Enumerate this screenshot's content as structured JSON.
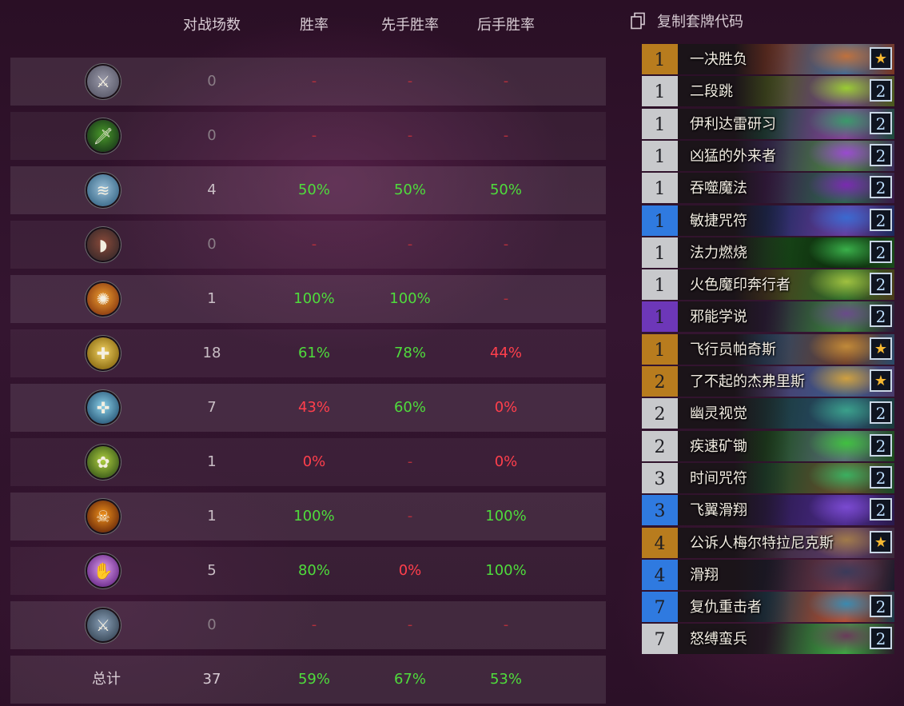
{
  "header": {
    "games": "对战场数",
    "winrate": "胜率",
    "first_winrate": "先手胜率",
    "second_winrate": "后手胜率"
  },
  "matchups": [
    {
      "icon": "warrior-class-icon",
      "games": "0",
      "winrate": "-",
      "first": "-",
      "second": "-"
    },
    {
      "icon": "rogue-class-icon",
      "games": "0",
      "winrate": "-",
      "first": "-",
      "second": "-"
    },
    {
      "icon": "shaman-class-icon",
      "games": "4",
      "winrate": "50%",
      "first": "50%",
      "second": "50%"
    },
    {
      "icon": "hunter-class-icon",
      "games": "0",
      "winrate": "-",
      "first": "-",
      "second": "-"
    },
    {
      "icon": "mage-class-icon",
      "games": "1",
      "winrate": "100%",
      "first": "100%",
      "second": "-"
    },
    {
      "icon": "paladin-class-icon",
      "games": "18",
      "winrate": "61%",
      "first": "78%",
      "second": "44%"
    },
    {
      "icon": "priest-class-icon",
      "games": "7",
      "winrate": "43%",
      "first": "60%",
      "second": "0%"
    },
    {
      "icon": "druid-class-icon",
      "games": "1",
      "winrate": "0%",
      "first": "-",
      "second": "0%"
    },
    {
      "icon": "warlock-class-icon",
      "games": "1",
      "winrate": "100%",
      "first": "-",
      "second": "100%"
    },
    {
      "icon": "demon-hunter-class-icon",
      "games": "5",
      "winrate": "80%",
      "first": "0%",
      "second": "100%"
    },
    {
      "icon": "death-knight-class-icon",
      "games": "0",
      "winrate": "-",
      "first": "-",
      "second": "-"
    }
  ],
  "total": {
    "label": "总计",
    "games": "37",
    "winrate": "59%",
    "first": "67%",
    "second": "53%"
  },
  "colors": {
    "win": "#4fdc3c",
    "loss": "#ff3f4c",
    "dash": "#b3303c",
    "common": "#c8c9cc",
    "legendary": "#b87c1e",
    "rare": "#2f7ae0",
    "epic": "#6d37b8"
  },
  "copy_deck": {
    "label": "复制套牌代码",
    "icon": "copy-icon"
  },
  "deck": [
    {
      "cost": "1",
      "name": "一决胜负",
      "rarity": "legendary",
      "qty": "★",
      "art": [
        "#7a3520",
        "#c0703c",
        "#3a6a9a"
      ]
    },
    {
      "cost": "1",
      "name": "二段跳",
      "rarity": "common",
      "qty": "2",
      "art": [
        "#4a5a1a",
        "#9acd32",
        "#6b3a8a"
      ]
    },
    {
      "cost": "1",
      "name": "伊利达雷研习",
      "rarity": "common",
      "qty": "2",
      "art": [
        "#1a4a3a",
        "#3a9a6a",
        "#8a3a9a"
      ]
    },
    {
      "cost": "1",
      "name": "凶猛的外来者",
      "rarity": "common",
      "qty": "2",
      "art": [
        "#3a2a5a",
        "#9a4ad0",
        "#4a8a3a"
      ]
    },
    {
      "cost": "1",
      "name": "吞噬魔法",
      "rarity": "common",
      "qty": "2",
      "art": [
        "#3a1a4a",
        "#7a2ab0",
        "#2a6a4a"
      ]
    },
    {
      "cost": "1",
      "name": "敏捷咒符",
      "rarity": "rare",
      "qty": "2",
      "art": [
        "#1a2a5a",
        "#3a6ad0",
        "#6a3a9a"
      ]
    },
    {
      "cost": "1",
      "name": "法力燃烧",
      "rarity": "common",
      "qty": "2",
      "art": [
        "#1a4a1a",
        "#3ab04a",
        "#0a2a0a"
      ]
    },
    {
      "cost": "1",
      "name": "火色魔印奔行者",
      "rarity": "common",
      "qty": "2",
      "art": [
        "#4a3a1a",
        "#a0c040",
        "#2a6a2a"
      ]
    },
    {
      "cost": "1",
      "name": "邪能学说",
      "rarity": "epic",
      "qty": "2",
      "art": [
        "#2a1a3a",
        "#6a4a8a",
        "#3a8a3a"
      ]
    },
    {
      "cost": "1",
      "name": "飞行员帕奇斯",
      "rarity": "legendary",
      "qty": "★",
      "art": [
        "#2a4a6a",
        "#c08a3a",
        "#6a3a2a"
      ]
    },
    {
      "cost": "2",
      "name": "了不起的杰弗里斯",
      "rarity": "legendary",
      "qty": "★",
      "art": [
        "#4a3a6a",
        "#d0a040",
        "#3a5a8a"
      ]
    },
    {
      "cost": "2",
      "name": "幽灵视觉",
      "rarity": "common",
      "qty": "2",
      "art": [
        "#1a3a3a",
        "#3aa08a",
        "#2a4a6a"
      ]
    },
    {
      "cost": "2",
      "name": "疾速矿锄",
      "rarity": "common",
      "qty": "2",
      "art": [
        "#1a4a1a",
        "#40c040",
        "#5a6a7a"
      ]
    },
    {
      "cost": "3",
      "name": "时间咒符",
      "rarity": "common",
      "qty": "2",
      "art": [
        "#1a4a2a",
        "#3ab060",
        "#6a4a2a"
      ]
    },
    {
      "cost": "3",
      "name": "飞翼滑翔",
      "rarity": "rare",
      "qty": "2",
      "art": [
        "#2a1a4a",
        "#7a4ad0",
        "#4a2a8a"
      ]
    },
    {
      "cost": "4",
      "name": "公诉人梅尔特拉尼克斯",
      "rarity": "legendary",
      "qty": "★",
      "art": [
        "#3a2a3a",
        "#a07a4a",
        "#5a3a6a"
      ]
    },
    {
      "cost": "4",
      "name": "滑翔",
      "rarity": "rare",
      "qty": "",
      "art": [
        "#1a1a2a",
        "#3a3a5a",
        "#7a3a4a"
      ]
    },
    {
      "cost": "7",
      "name": "复仇重击者",
      "rarity": "rare",
      "qty": "2",
      "art": [
        "#1a3a4a",
        "#3a8ab0",
        "#c04a2a"
      ]
    },
    {
      "cost": "7",
      "name": "怒缚蛮兵",
      "rarity": "common",
      "qty": "2",
      "art": [
        "#2a1a2a",
        "#6a3a5a",
        "#3ab040"
      ]
    }
  ]
}
